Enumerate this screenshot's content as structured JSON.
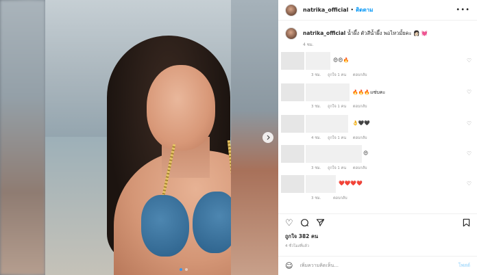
{
  "post": {
    "username": "natrika_official",
    "separator": "•",
    "follow_label": "ติดตาม",
    "more_icon": "more-icon",
    "caption_text": "น้ำผึ้ง ตัวสีน้ำผึ้ง พอไหวมั้ยคะ 👩🏻 💓",
    "caption_time": "4 ชม."
  },
  "comments": [
    {
      "emoji": "😍😍🔥",
      "time": "3 ชม.",
      "likes": "ถูกใจ 1 คน",
      "reply": "ตอบกลับ"
    },
    {
      "emoji": "🔥🔥🔥แซ่บคะ",
      "time": "3 ชม.",
      "likes": "ถูกใจ 1 คน",
      "reply": "ตอบกลับ"
    },
    {
      "emoji": "👌🖤🖤",
      "time": "4 ชม.",
      "likes": "ถูกใจ 1 คน",
      "reply": "ตอบกลับ"
    },
    {
      "emoji": "😍",
      "time": "3 ชม.",
      "likes": "ถูกใจ 1 คน",
      "reply": "ตอบกลับ"
    },
    {
      "emoji": "❤️❤️❤️❤️",
      "time": "3 ชม.",
      "likes": "",
      "reply": "ตอบกลับ"
    }
  ],
  "actions": {
    "likes_count": "ถูกใจ 382 คน",
    "time_ago": "4 ชั่วโมงที่แล้ว"
  },
  "add_comment": {
    "placeholder": "เพิ่มความคิดเห็น...",
    "post_label": "โพสต์"
  },
  "carousel": {
    "slides": 2,
    "active": 1
  }
}
